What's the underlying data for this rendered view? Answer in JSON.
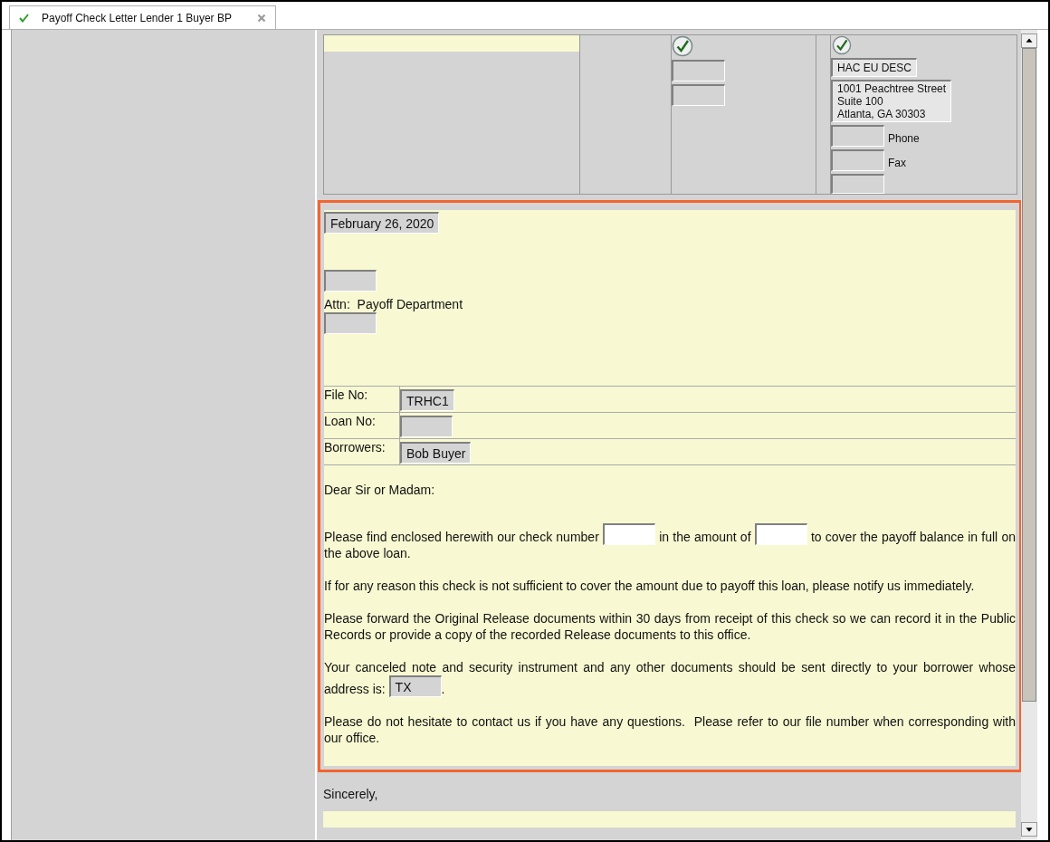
{
  "tab": {
    "label": "Payoff Check Letter Lender 1 Buyer BP",
    "selected": true
  },
  "header_block": {
    "column_3": {
      "checked": true
    },
    "column_4": {
      "checked": true,
      "name": "HAC EU DESC",
      "address_lines": [
        "1001 Peachtree Street",
        "Suite 100",
        "Atlanta, GA 30303"
      ],
      "phone_label": "Phone",
      "fax_label": "Fax"
    }
  },
  "letter": {
    "selected": true,
    "date": "February 26, 2020",
    "attn": "Attn:  Payoff Department",
    "info_rows": [
      {
        "label": "File No:",
        "value": "TRHC1"
      },
      {
        "label": "Loan No:"
      },
      {
        "label": "Borrowers:",
        "value": "Bob Buyer"
      }
    ],
    "greeting": "Dear Sir or Madam:",
    "paragraphs": [
      [
        {
          "kind": "text",
          "text": "Please find enclosed herewith our check number "
        },
        {
          "kind": "blank"
        },
        {
          "kind": "text",
          "text": " in the amount of "
        },
        {
          "kind": "blank"
        },
        {
          "kind": "text",
          "text": " to cover the payoff balance in full on the above loan."
        }
      ],
      [
        {
          "kind": "text",
          "text": "If for any reason this check is not sufficient to cover the amount due to payoff this loan, please notify us immediately."
        }
      ],
      [
        {
          "kind": "text",
          "text": "Please forward the Original Release documents within 30 days from receipt of this check so we can record it in the Public Records or provide a copy of the recorded Release documents to this office."
        }
      ],
      [
        {
          "kind": "text",
          "text": "Your canceled note and security instrument and any other documents should be sent directly to your borrower whose address is: "
        },
        {
          "kind": "field",
          "value": "TX"
        },
        {
          "kind": "text",
          "text": "."
        }
      ],
      [
        {
          "kind": "text",
          "text": "Please do not hesitate to contact us if you have any questions.  Please refer to our file number when corresponding with our office."
        }
      ]
    ]
  },
  "closing": "Sincerely,"
}
